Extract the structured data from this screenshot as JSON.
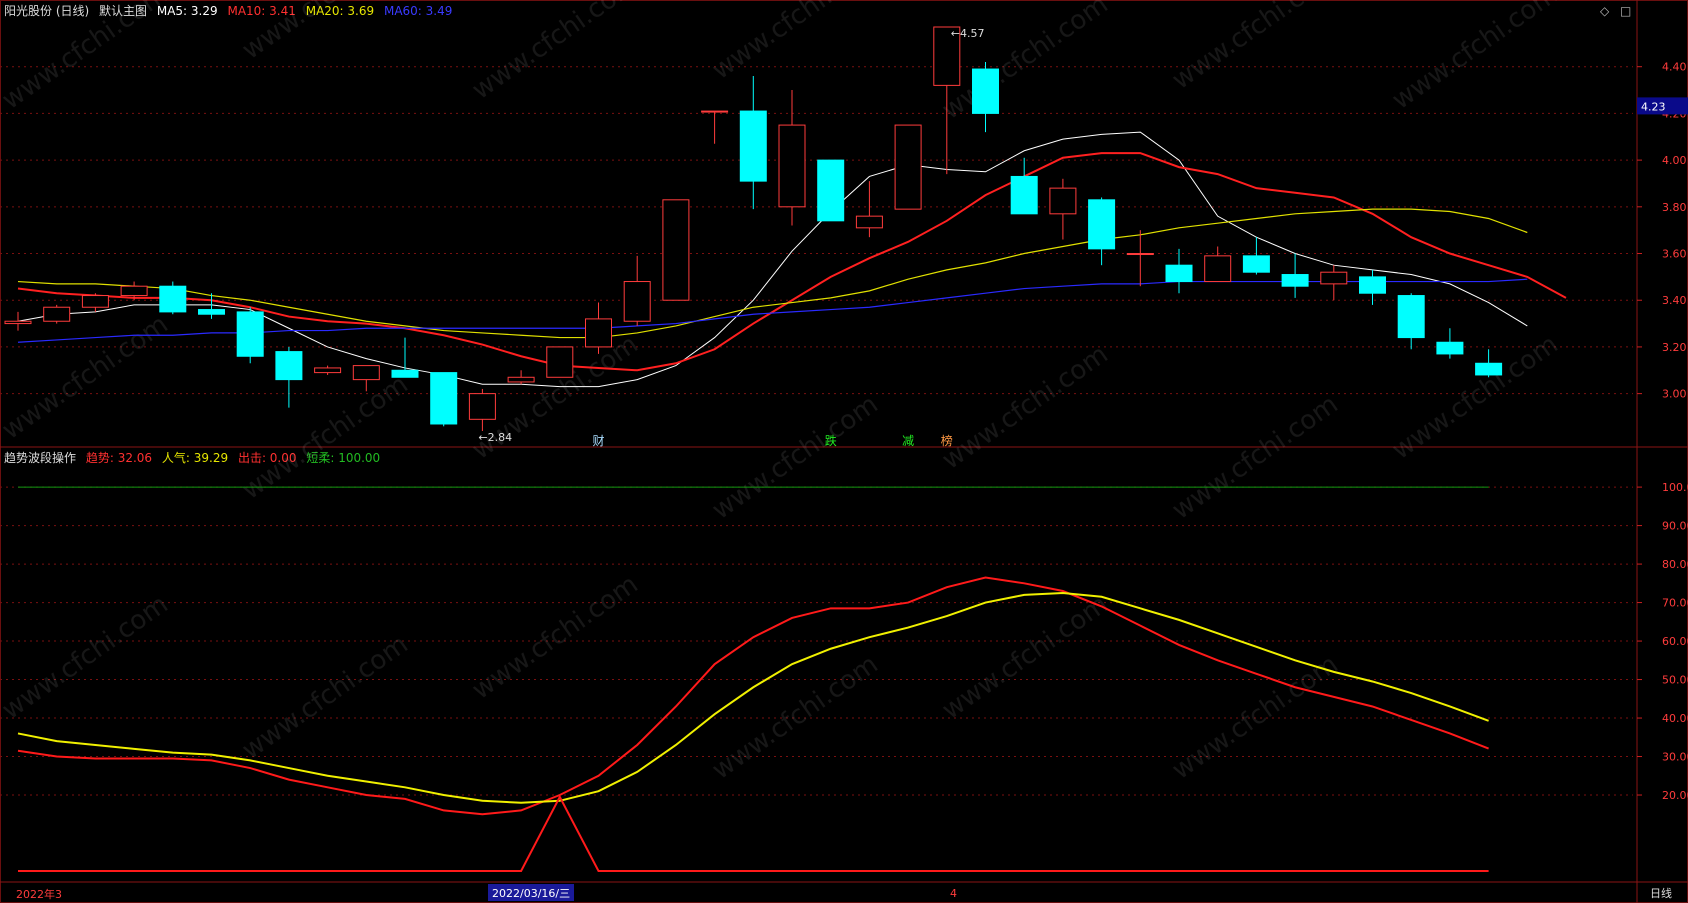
{
  "main_header": {
    "stock": "阳光股份 (日线)",
    "view": "默认主图",
    "ma5": "MA5: 3.29",
    "ma10": "MA10: 3.41",
    "ma20": "MA20: 3.69",
    "ma60": "MA60: 3.49"
  },
  "sub_header": {
    "name": "趋势波段操作",
    "trend": "趋势: 32.06",
    "popularity": "人气: 39.29",
    "exit": "出击: 0.00",
    "short": "短柔: 100.00"
  },
  "price_badge": "4.23",
  "high_label": "4.57",
  "low_label": "2.84",
  "event_markers": [
    "财",
    "跌",
    "减",
    "榜"
  ],
  "footer": {
    "left_date": "2022年3",
    "cursor_date": "2022/03/16/三",
    "month": "4",
    "period": "日线"
  },
  "watermark": "www.cfchi.com",
  "colors": {
    "up": "#ff3c3c",
    "down": "#00ffff",
    "ma5": "#ffffff",
    "ma10": "#ff2020",
    "ma20": "#e0e000",
    "ma60": "#2a2aff",
    "grid": "#7a1010"
  },
  "chart_data": [
    {
      "type": "candlestick",
      "title": "阳光股份 (日线)",
      "y_ticks": [
        3.0,
        3.2,
        3.4,
        3.6,
        3.8,
        4.0,
        4.2,
        4.4
      ],
      "y_tick_labels": [
        "3.00",
        "3.20",
        "3.40",
        "3.60",
        "3.80",
        "4.00",
        "4.20",
        "4.40"
      ],
      "ylim": [
        2.78,
        4.6
      ],
      "candles": [
        {
          "o": 3.3,
          "h": 3.35,
          "l": 3.27,
          "c": 3.31
        },
        {
          "o": 3.31,
          "h": 3.38,
          "l": 3.3,
          "c": 3.37
        },
        {
          "o": 3.37,
          "h": 3.43,
          "l": 3.35,
          "c": 3.42
        },
        {
          "o": 3.42,
          "h": 3.48,
          "l": 3.4,
          "c": 3.46
        },
        {
          "o": 3.46,
          "h": 3.48,
          "l": 3.34,
          "c": 3.35
        },
        {
          "o": 3.36,
          "h": 3.43,
          "l": 3.32,
          "c": 3.34
        },
        {
          "o": 3.35,
          "h": 3.37,
          "l": 3.13,
          "c": 3.16
        },
        {
          "o": 3.18,
          "h": 3.2,
          "l": 2.94,
          "c": 3.06
        },
        {
          "o": 3.09,
          "h": 3.12,
          "l": 3.08,
          "c": 3.11
        },
        {
          "o": 3.06,
          "h": 3.12,
          "l": 3.01,
          "c": 3.12
        },
        {
          "o": 3.1,
          "h": 3.24,
          "l": 3.07,
          "c": 3.07
        },
        {
          "o": 3.09,
          "h": 3.09,
          "l": 2.86,
          "c": 2.87
        },
        {
          "o": 2.89,
          "h": 3.02,
          "l": 2.84,
          "c": 3.0
        },
        {
          "o": 3.05,
          "h": 3.1,
          "l": 3.04,
          "c": 3.07
        },
        {
          "o": 3.07,
          "h": 3.2,
          "l": 3.07,
          "c": 3.2
        },
        {
          "o": 3.2,
          "h": 3.39,
          "l": 3.17,
          "c": 3.32
        },
        {
          "o": 3.31,
          "h": 3.59,
          "l": 3.29,
          "c": 3.48
        },
        {
          "o": 3.4,
          "h": 3.83,
          "l": 3.4,
          "c": 3.83
        },
        {
          "o": 4.21,
          "h": 4.21,
          "l": 4.07,
          "c": 4.21
        },
        {
          "o": 4.21,
          "h": 4.36,
          "l": 3.79,
          "c": 3.91
        },
        {
          "o": 3.8,
          "h": 4.3,
          "l": 3.72,
          "c": 4.15
        },
        {
          "o": 4.0,
          "h": 4.0,
          "l": 3.74,
          "c": 3.74
        },
        {
          "o": 3.71,
          "h": 3.91,
          "l": 3.67,
          "c": 3.76
        },
        {
          "o": 3.79,
          "h": 4.15,
          "l": 3.79,
          "c": 4.15
        },
        {
          "o": 4.32,
          "h": 4.57,
          "l": 3.94,
          "c": 4.57
        },
        {
          "o": 4.39,
          "h": 4.42,
          "l": 4.12,
          "c": 4.2
        },
        {
          "o": 3.93,
          "h": 4.01,
          "l": 3.77,
          "c": 3.77
        },
        {
          "o": 3.77,
          "h": 3.92,
          "l": 3.66,
          "c": 3.88
        },
        {
          "o": 3.83,
          "h": 3.84,
          "l": 3.55,
          "c": 3.62
        },
        {
          "o": 3.6,
          "h": 3.7,
          "l": 3.46,
          "c": 3.6
        },
        {
          "o": 3.55,
          "h": 3.62,
          "l": 3.43,
          "c": 3.48
        },
        {
          "o": 3.48,
          "h": 3.63,
          "l": 3.48,
          "c": 3.59
        },
        {
          "o": 3.59,
          "h": 3.67,
          "l": 3.51,
          "c": 3.52
        },
        {
          "o": 3.51,
          "h": 3.6,
          "l": 3.41,
          "c": 3.46
        },
        {
          "o": 3.47,
          "h": 3.55,
          "l": 3.4,
          "c": 3.52
        },
        {
          "o": 3.5,
          "h": 3.53,
          "l": 3.38,
          "c": 3.43
        },
        {
          "o": 3.42,
          "h": 3.43,
          "l": 3.19,
          "c": 3.24
        },
        {
          "o": 3.22,
          "h": 3.28,
          "l": 3.15,
          "c": 3.17
        },
        {
          "o": 3.13,
          "h": 3.19,
          "l": 3.07,
          "c": 3.08
        }
      ],
      "series": [
        {
          "name": "MA5",
          "values": [
            3.31,
            3.34,
            3.35,
            3.38,
            3.38,
            3.38,
            3.36,
            3.28,
            3.2,
            3.15,
            3.11,
            3.08,
            3.04,
            3.04,
            3.03,
            3.03,
            3.06,
            3.12,
            3.24,
            3.4,
            3.61,
            3.78,
            3.93,
            3.98,
            3.96,
            3.95,
            4.04,
            4.09,
            4.11,
            4.12,
            4.0,
            3.76,
            3.67,
            3.6,
            3.55,
            3.53,
            3.51,
            3.47,
            3.39,
            3.29
          ]
        },
        {
          "name": "MA10",
          "values": [
            3.45,
            3.43,
            3.42,
            3.41,
            3.41,
            3.4,
            3.37,
            3.33,
            3.31,
            3.3,
            3.28,
            3.25,
            3.21,
            3.16,
            3.12,
            3.11,
            3.1,
            3.13,
            3.19,
            3.3,
            3.4,
            3.5,
            3.58,
            3.65,
            3.74,
            3.85,
            3.93,
            4.01,
            4.03,
            4.03,
            3.97,
            3.94,
            3.88,
            3.86,
            3.84,
            3.77,
            3.67,
            3.6,
            3.55,
            3.5,
            3.41
          ]
        },
        {
          "name": "MA20",
          "values": [
            3.48,
            3.47,
            3.47,
            3.46,
            3.45,
            3.42,
            3.4,
            3.37,
            3.34,
            3.31,
            3.29,
            3.27,
            3.26,
            3.25,
            3.24,
            3.24,
            3.26,
            3.29,
            3.33,
            3.37,
            3.39,
            3.41,
            3.44,
            3.49,
            3.53,
            3.56,
            3.6,
            3.63,
            3.66,
            3.68,
            3.71,
            3.73,
            3.75,
            3.77,
            3.78,
            3.79,
            3.79,
            3.78,
            3.75,
            3.69
          ]
        },
        {
          "name": "MA60",
          "values": [
            3.22,
            3.23,
            3.24,
            3.25,
            3.25,
            3.26,
            3.26,
            3.27,
            3.27,
            3.28,
            3.28,
            3.28,
            3.28,
            3.28,
            3.28,
            3.28,
            3.29,
            3.3,
            3.32,
            3.34,
            3.35,
            3.36,
            3.37,
            3.39,
            3.41,
            3.43,
            3.45,
            3.46,
            3.47,
            3.47,
            3.48,
            3.48,
            3.48,
            3.48,
            3.48,
            3.48,
            3.48,
            3.48,
            3.48,
            3.49
          ]
        }
      ]
    },
    {
      "type": "line",
      "title": "趋势波段操作",
      "y_ticks": [
        20,
        30,
        40,
        50,
        60,
        70,
        80,
        90,
        100
      ],
      "y_tick_labels": [
        "20.00",
        "30.00",
        "40.00",
        "50.00",
        "60.00",
        "70.00",
        "80.00",
        "90.00",
        "100.0"
      ],
      "ylim": [
        0,
        106
      ],
      "series": [
        {
          "name": "趋势",
          "values": [
            31.5,
            30,
            29.5,
            29.5,
            29.5,
            29,
            27,
            24,
            22,
            20,
            19,
            16,
            15,
            16,
            20,
            25,
            33,
            43,
            54,
            61,
            66,
            68.5,
            68.5,
            70,
            74,
            76.5,
            75,
            73,
            69,
            64,
            59,
            55,
            51.5,
            48,
            45.5,
            43,
            39.5,
            36,
            32.06
          ]
        },
        {
          "name": "人气",
          "values": [
            36,
            34,
            33,
            32,
            31,
            30.5,
            29,
            27,
            25,
            23.5,
            22,
            20,
            18.5,
            18,
            18.5,
            21,
            26,
            33,
            41,
            48,
            54,
            58,
            61,
            63.5,
            66.5,
            70,
            72,
            72.5,
            71.5,
            68.5,
            65.5,
            62,
            58.5,
            55,
            52,
            49.5,
            46.5,
            43,
            39.29
          ]
        },
        {
          "name": "出击",
          "values": [
            0,
            0,
            0,
            0,
            0,
            0,
            0,
            0,
            0,
            0,
            0,
            0,
            0,
            0,
            19.5,
            0,
            0,
            0,
            0,
            0,
            0,
            0,
            0,
            0,
            0,
            0,
            0,
            0,
            0,
            0,
            0,
            0,
            0,
            0,
            0,
            0,
            0,
            0,
            0
          ]
        },
        {
          "name": "短柔",
          "values": [
            100,
            100,
            100,
            100,
            100,
            100,
            100,
            100,
            100,
            100,
            100,
            100,
            100,
            100,
            100,
            100,
            100,
            100,
            100,
            100,
            100,
            100,
            100,
            100,
            100,
            100,
            100,
            100,
            100,
            100,
            100,
            100,
            100,
            100,
            100,
            100,
            100,
            100,
            100
          ]
        }
      ]
    }
  ]
}
